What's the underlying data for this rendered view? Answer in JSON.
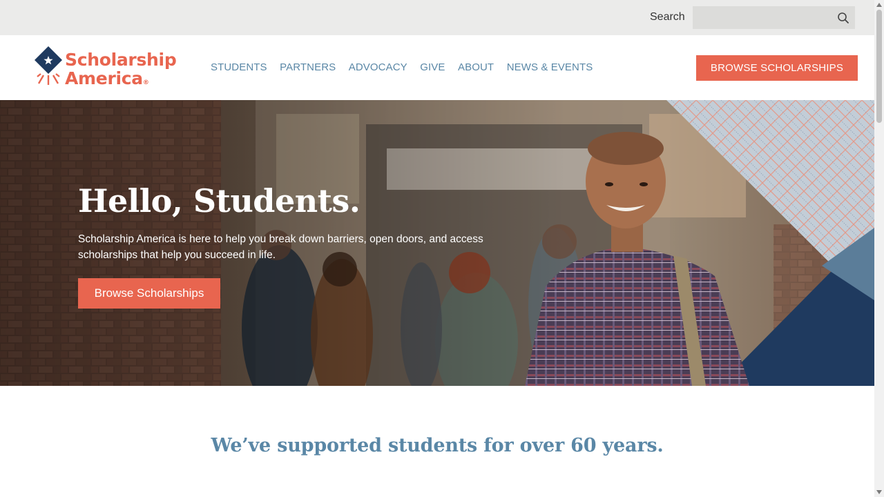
{
  "utility": {
    "search_label": "Search",
    "search_placeholder": "",
    "search_icon": "search-icon"
  },
  "header": {
    "logo_line1": "Scholarship",
    "logo_line2": "America",
    "logo_mark": "®",
    "nav": [
      "STUDENTS",
      "PARTNERS",
      "ADVOCACY",
      "GIVE",
      "ABOUT",
      "NEWS & EVENTS"
    ],
    "cta_label": "BROWSE SCHOLARSHIPS"
  },
  "hero": {
    "title": "Hello, Students.",
    "subtitle": "Scholarship America is here to help you break down barriers, open doors, and access scholarships that help you succeed in life.",
    "button_label": "Browse Scholarships"
  },
  "section": {
    "heading": "We’ve supported students for over 60 years."
  },
  "colors": {
    "accent": "#e8654f",
    "nav_blue": "#5a87a6",
    "navy": "#1f3a5f",
    "utility_bg": "#ebebea"
  }
}
